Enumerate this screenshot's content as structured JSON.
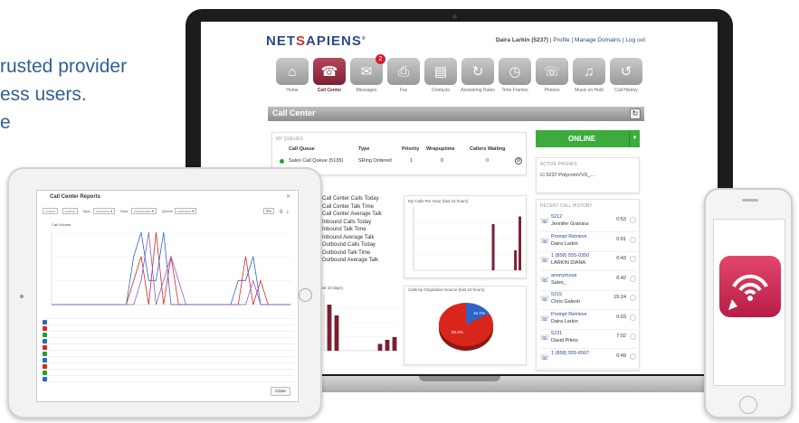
{
  "promo": {
    "line1": "rusted  provider",
    "line2": "ess users.",
    "line3": "e"
  },
  "header": {
    "logo_left": "NET",
    "logo_s": "S",
    "logo_right": "APIENS",
    "user": "Daira Larkin (5237)",
    "profile_link": "Profile",
    "domains_link": "Manage Domains",
    "logout_link": "Log out"
  },
  "nav": [
    {
      "label": "Home",
      "icon": "home-icon",
      "glyph": "⌂"
    },
    {
      "label": "Call Center",
      "icon": "headset-icon",
      "glyph": "☎",
      "active": true
    },
    {
      "label": "Messages",
      "icon": "envelope-icon",
      "glyph": "✉",
      "badge": "2"
    },
    {
      "label": "Fax",
      "icon": "fax-icon",
      "glyph": "⎙"
    },
    {
      "label": "Contacts",
      "icon": "contacts-icon",
      "glyph": "▤"
    },
    {
      "label": "Answering Rules",
      "icon": "rules-icon",
      "glyph": "↻"
    },
    {
      "label": "Time Frames",
      "icon": "clock-icon",
      "glyph": "◷"
    },
    {
      "label": "Phones",
      "icon": "phone-icon",
      "glyph": "☏"
    },
    {
      "label": "Music on Hold",
      "icon": "music-icon",
      "glyph": "♫"
    },
    {
      "label": "Call History",
      "icon": "history-icon",
      "glyph": "↺"
    }
  ],
  "callcenter": {
    "title": "Call Center",
    "queues_title": "MY QUEUES",
    "headers": {
      "queue": "Call Queue",
      "type": "Type",
      "priority": "Priority",
      "wrapup": "Wrapuptime",
      "waiting": "Callers Waiting"
    },
    "row": {
      "queue": "Sales Call Queue (5135)",
      "type": "SRing Ordered",
      "priority": "1",
      "wrapup": "0",
      "waiting": "0"
    }
  },
  "status": {
    "label": "ONLINE"
  },
  "phones": {
    "title": "ACTIVE PHONES",
    "row": "5237  PolycomVVX_..."
  },
  "stats": [
    "Call Center Calls Today",
    "Call Center Talk Time",
    "Call Center Average Talk",
    "Inbound Calls Today",
    "Inbound Talk Time",
    "Inbound Average Talk",
    "Outbound Calls Today",
    "Outbound Talk Time",
    "Outbound Average Talk"
  ],
  "charts": {
    "calls_hour_title": "My Calls Per Hour (last 24 hours)",
    "last10_title": "(last 10 days)",
    "origin_title": "Calls by Origination Source (last 24 hours)",
    "pie_blue_label": "16.7%",
    "pie_red_label": "83.3%"
  },
  "history": {
    "title": "RECENT CALL HISTORY",
    "items": [
      {
        "number": "5212",
        "name": "Jennifer Granara",
        "time": "0:53"
      },
      {
        "number": "Prompt Retrieve",
        "name": "Daira Larkin",
        "time": "0:01"
      },
      {
        "number": "1 (858) 555-0350",
        "name": "LARKIN DIANA",
        "time": "0:43"
      },
      {
        "number": "anonymous",
        "name": "Sales_",
        "time": "0:42"
      },
      {
        "number": "5215",
        "name": "Chris Galeoti",
        "time": "15:24"
      },
      {
        "number": "Prompt Retrieve",
        "name": "Daira Larkin",
        "time": "0:03"
      },
      {
        "number": "5231",
        "name": "David Pifeto",
        "time": "7:02"
      },
      {
        "number": "1 (858) 555-6507",
        "name": "",
        "time": "0:49"
      }
    ]
  },
  "tablet": {
    "title": "Call Center Reports",
    "legend": "Call Volume",
    "close": "Close",
    "filters": [
      "Type",
      "Dept",
      "Queue"
    ]
  },
  "chart_data": [
    {
      "type": "bar",
      "title": "My Calls Per Hour (last 24 hours)",
      "series": [
        {
          "values": [
            0,
            0,
            0,
            0,
            0,
            0,
            0,
            0,
            0,
            0,
            0,
            0,
            0,
            0,
            0,
            0,
            0,
            3,
            0,
            0,
            0,
            0,
            1.3,
            3.5
          ]
        }
      ],
      "colors": [
        "#7a1f31"
      ]
    },
    {
      "type": "bar",
      "title": "(last 10 days)",
      "series": [
        {
          "values": [
            3.4,
            2.6,
            0,
            0,
            0,
            0,
            0,
            0.5,
            0.8,
            1
          ]
        }
      ],
      "colors": [
        "#7a1f31"
      ]
    },
    {
      "type": "pie",
      "title": "Calls by Origination Source (last 24 hours)",
      "values": [
        16.7,
        83.3
      ],
      "colors": [
        "#2f64c9",
        "#d9261c"
      ]
    },
    {
      "type": "line",
      "title": "Call Volume",
      "series": [
        {
          "values": [
            0,
            0,
            0,
            0,
            0,
            0,
            0,
            0,
            0,
            0,
            0,
            1,
            2,
            0,
            3,
            0,
            2,
            0,
            0,
            0,
            0,
            0,
            0,
            0,
            0,
            0,
            2,
            0,
            1,
            0,
            0,
            0,
            0
          ]
        },
        {
          "values": [
            0,
            0,
            0,
            0,
            0,
            0,
            0,
            0,
            0,
            0,
            0,
            2,
            3,
            1,
            1,
            3,
            0,
            0,
            0,
            0,
            0,
            0,
            0,
            0,
            0,
            1,
            1,
            2,
            0,
            0,
            0,
            0,
            0
          ]
        },
        {
          "values": [
            0,
            0,
            0,
            0,
            0,
            0,
            0,
            0,
            0,
            0,
            0,
            0,
            1,
            3,
            0,
            1,
            2,
            1,
            0,
            0,
            0,
            0,
            0,
            0,
            0,
            0,
            0,
            1,
            0,
            0,
            0,
            0,
            0
          ]
        }
      ],
      "colors": [
        "#d9261c",
        "#2f64c9",
        "#8a5bd0"
      ]
    }
  ]
}
